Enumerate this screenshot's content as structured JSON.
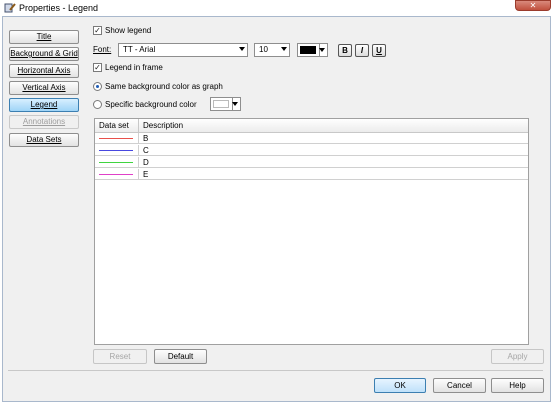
{
  "window": {
    "title": "Properties - Legend",
    "close_glyph": "✕"
  },
  "sidebar": {
    "items": [
      {
        "label": "Title"
      },
      {
        "label": "Background & Grid"
      },
      {
        "label": "Horizontal Axis"
      },
      {
        "label": "Vertical Axis"
      },
      {
        "label": "Legend"
      },
      {
        "label": "Annotations"
      },
      {
        "label": "Data Sets"
      }
    ]
  },
  "options": {
    "show_legend": {
      "label": "Show legend",
      "checked": true
    },
    "font_label": "Font:",
    "font_value": "TT - Arial",
    "size_value": "10",
    "bold": "B",
    "italic": "I",
    "underline": "U",
    "legend_in_frame": {
      "label": "Legend in frame",
      "checked": true
    },
    "same_bg": {
      "label": "Same background color as graph",
      "selected": true
    },
    "specific_bg": {
      "label": "Specific background color",
      "selected": false
    }
  },
  "table": {
    "headers": [
      "Data set",
      "Description"
    ],
    "rows": [
      {
        "description": "B",
        "color": "#e8504a"
      },
      {
        "description": "C",
        "color": "#4848e0"
      },
      {
        "description": "D",
        "color": "#3fd43f"
      },
      {
        "description": "E",
        "color": "#e040c8"
      }
    ]
  },
  "buttons": {
    "reset": "Reset",
    "default": "Default",
    "apply": "Apply",
    "ok": "OK",
    "cancel": "Cancel",
    "help": "Help"
  }
}
